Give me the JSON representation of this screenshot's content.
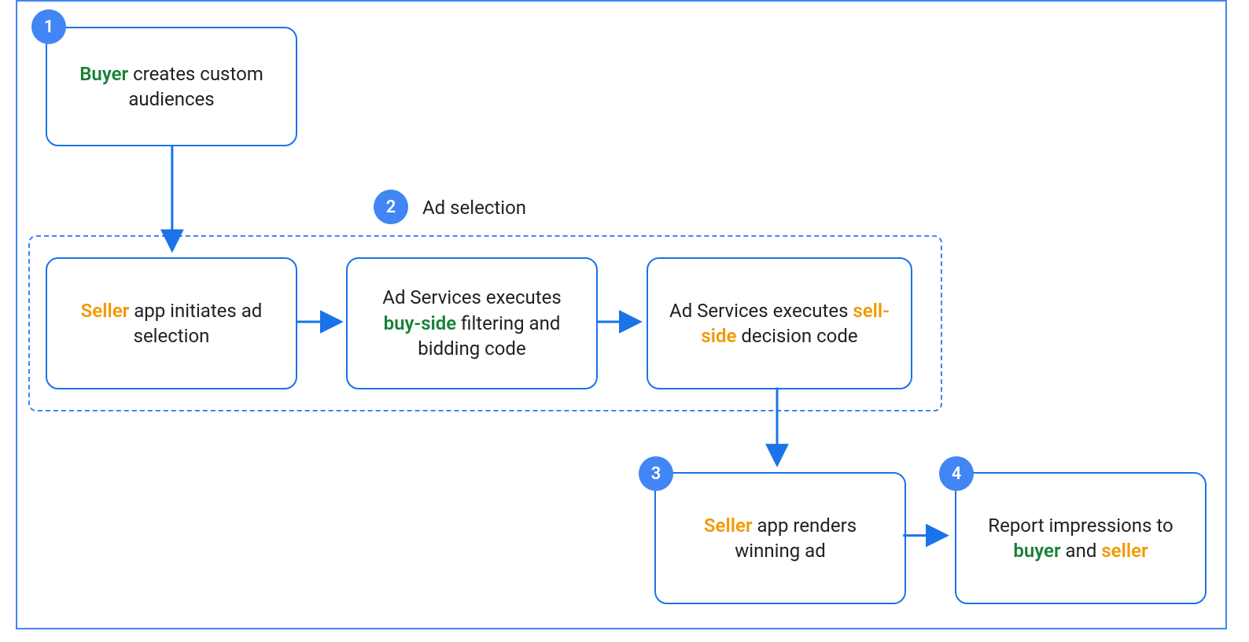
{
  "nodes": {
    "n1": {
      "badge": "1",
      "parts": [
        {
          "text": "Buyer",
          "cls": "green"
        },
        {
          "text": " creates custom audiences"
        }
      ]
    },
    "n2a": {
      "parts": [
        {
          "text": "Seller",
          "cls": "orange"
        },
        {
          "text": " app initiates ad selection"
        }
      ]
    },
    "n2b": {
      "parts": [
        {
          "text": "Ad Services executes "
        },
        {
          "text": "buy-side",
          "cls": "green"
        },
        {
          "text": " filtering and bidding code"
        }
      ]
    },
    "n2c": {
      "parts": [
        {
          "text": "Ad Services executes "
        },
        {
          "text": "sell-side",
          "cls": "orange"
        },
        {
          "text": " decision code"
        }
      ]
    },
    "n3": {
      "badge": "3",
      "parts": [
        {
          "text": "Seller",
          "cls": "orange"
        },
        {
          "text": " app renders winning ad"
        }
      ]
    },
    "n4": {
      "badge": "4",
      "parts": [
        {
          "text": "Report impressions to "
        },
        {
          "text": "buyer",
          "cls": "green"
        },
        {
          "text": " and "
        },
        {
          "text": "seller",
          "cls": "orange"
        }
      ]
    }
  },
  "group2": {
    "badge": "2",
    "label": "Ad selection"
  }
}
